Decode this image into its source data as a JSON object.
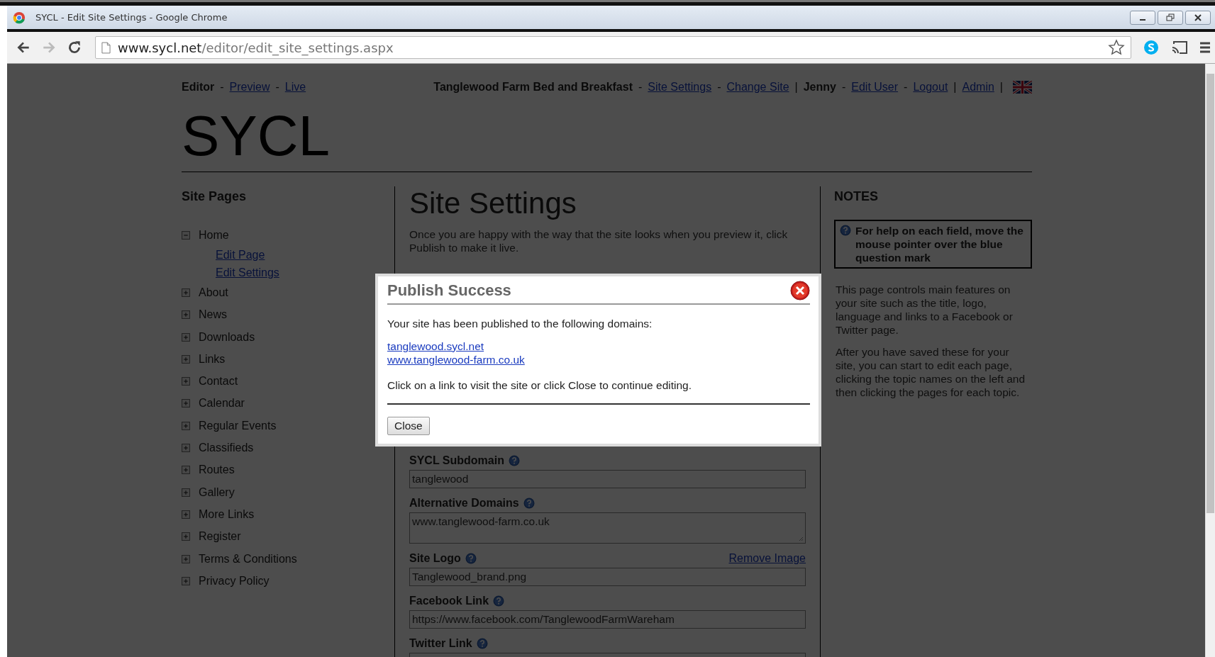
{
  "browser": {
    "title": "SYCL - Edit Site Settings - Google Chrome",
    "url_host": "www.sycl.net",
    "url_path": "/editor/edit_site_settings.aspx"
  },
  "header": {
    "left": [
      {
        "kind": "label",
        "text": "Editor"
      },
      {
        "kind": "sep",
        "text": "-"
      },
      {
        "kind": "link",
        "text": "Preview"
      },
      {
        "kind": "sep",
        "text": "-"
      },
      {
        "kind": "link",
        "text": "Live"
      }
    ],
    "right": [
      {
        "kind": "label",
        "text": "Tanglewood Farm Bed and Breakfast"
      },
      {
        "kind": "sep",
        "text": "-"
      },
      {
        "kind": "link",
        "text": "Site Settings"
      },
      {
        "kind": "sep",
        "text": "-"
      },
      {
        "kind": "link",
        "text": "Change Site"
      },
      {
        "kind": "sep",
        "text": "|"
      },
      {
        "kind": "label",
        "text": "Jenny"
      },
      {
        "kind": "sep",
        "text": "-"
      },
      {
        "kind": "link",
        "text": "Edit User"
      },
      {
        "kind": "sep",
        "text": "-"
      },
      {
        "kind": "link",
        "text": "Logout"
      },
      {
        "kind": "sep",
        "text": "|"
      },
      {
        "kind": "link",
        "text": "Admin"
      },
      {
        "kind": "sep",
        "text": "|"
      }
    ]
  },
  "logo": "SYCL",
  "sidebar": {
    "title": "Site Pages",
    "items": [
      {
        "label": "Home",
        "expanded": true,
        "children": [
          {
            "label": "Edit Page"
          },
          {
            "label": "Edit Settings"
          }
        ]
      },
      {
        "label": "About",
        "expanded": false
      },
      {
        "label": "News",
        "expanded": false
      },
      {
        "label": "Downloads",
        "expanded": false
      },
      {
        "label": "Links",
        "expanded": false
      },
      {
        "label": "Contact",
        "expanded": false
      },
      {
        "label": "Calendar",
        "expanded": false
      },
      {
        "label": "Regular Events",
        "expanded": false
      },
      {
        "label": "Classifieds",
        "expanded": false
      },
      {
        "label": "Routes",
        "expanded": false
      },
      {
        "label": "Gallery",
        "expanded": false
      },
      {
        "label": "More Links",
        "expanded": false
      },
      {
        "label": "Register",
        "expanded": false
      },
      {
        "label": "Terms & Conditions",
        "expanded": false
      },
      {
        "label": "Privacy Policy",
        "expanded": false
      }
    ]
  },
  "main": {
    "title": "Site Settings",
    "intro": "Once you are happy with the way that the site looks when you preview it, click Publish to make it live.",
    "fields": [
      {
        "label": "SYCL Subdomain",
        "kind": "input",
        "value": "tanglewood"
      },
      {
        "label": "Alternative Domains",
        "kind": "textarea",
        "value": "www.tanglewood-farm.co.uk"
      },
      {
        "label": "Site Logo",
        "kind": "input",
        "value": "Tanglewood_brand.png",
        "action": "Remove Image"
      },
      {
        "label": "Facebook Link",
        "kind": "input",
        "value": "https://www.facebook.com/TanglewoodFarmWareham"
      },
      {
        "label": "Twitter Link",
        "kind": "input"
      }
    ]
  },
  "notes": {
    "title": "NOTES",
    "help": "For help on each field, move the mouse pointer over the blue question mark",
    "paragraphs": [
      "This page controls main features on your site such as the title, logo, language and links to a Facebook or Twitter page.",
      "After you have saved these for your site, you can start to edit each page, clicking the topic names on the left and then clicking the pages for each topic."
    ]
  },
  "dialog": {
    "title": "Publish Success",
    "message": "Your site has been published to the following domains:",
    "links": [
      "tanglewood.sycl.net",
      "www.tanglewood-farm.co.uk"
    ],
    "footer": "Click on a link to visit the site or click Close to continue editing.",
    "button": "Close"
  }
}
